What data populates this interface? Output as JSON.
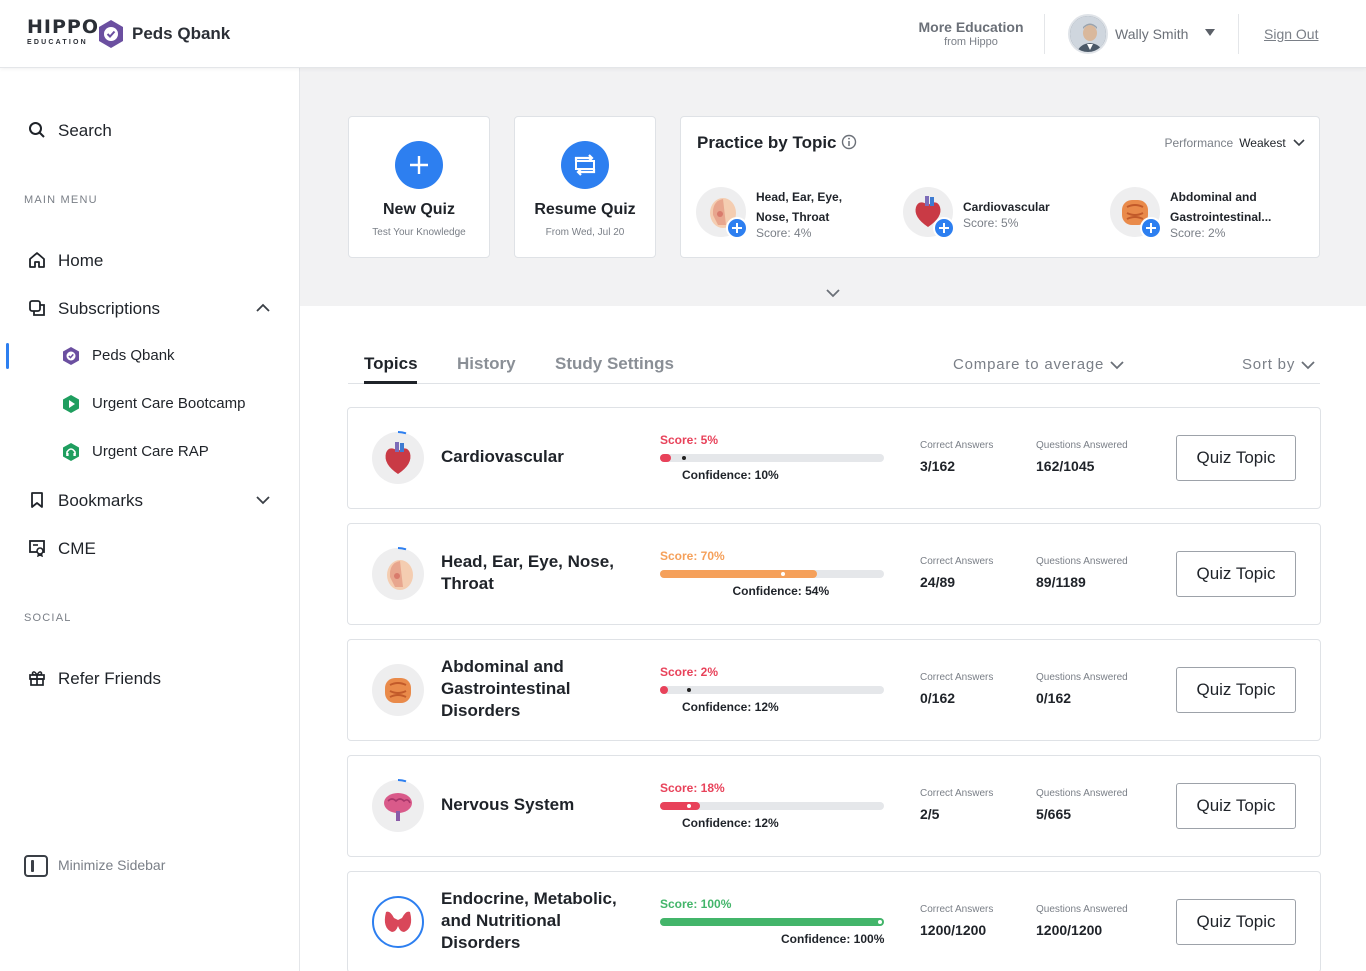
{
  "header": {
    "logo_main": "HIPPO",
    "logo_sub": "EDUCATION",
    "brand": "Peds Qbank",
    "more_title": "More Education",
    "more_sub": "from Hippo",
    "user_name": "Wally Smith",
    "sign_out": "Sign Out"
  },
  "sidebar": {
    "search": "Search",
    "main_menu": "MAIN MENU",
    "home": "Home",
    "subscriptions": "Subscriptions",
    "sub_items": [
      "Peds Qbank",
      "Urgent Care Bootcamp",
      "Urgent Care RAP"
    ],
    "bookmarks": "Bookmarks",
    "cme": "CME",
    "social": "SOCIAL",
    "refer": "Refer Friends",
    "minimize": "Minimize Sidebar"
  },
  "quick": {
    "new_title": "New Quiz",
    "new_sub": "Test Your Knowledge",
    "resume_title": "Resume Quiz",
    "resume_sub": "From Wed, Jul 20"
  },
  "practice": {
    "title": "Practice by Topic",
    "perf_label": "Performance",
    "perf_value": "Weakest",
    "items": [
      {
        "name": "Head, Ear, Eye, Nose, Throat",
        "score": "Score: 4%"
      },
      {
        "name": "Cardiovascular",
        "score": "Score: 5%"
      },
      {
        "name": "Abdominal and Gastrointestinal...",
        "score": "Score: 2%"
      }
    ]
  },
  "tabs": {
    "topics": "Topics",
    "history": "History",
    "settings": "Study Settings",
    "compare": "Compare to average",
    "sort": "Sort by"
  },
  "labels": {
    "correct": "Correct Answers",
    "answered": "Questions Answered",
    "quiz_btn": "Quiz Topic"
  },
  "topics": [
    {
      "name": "Cardiovascular",
      "score_text": "Score: 5%",
      "score": 5,
      "confidence_text": "Confidence: 10%",
      "confidence": 10,
      "correct": "3/162",
      "answered": "162/1045",
      "color": "#e8425a"
    },
    {
      "name": "Head, Ear, Eye, Nose, Throat",
      "score_text": "Score: 70%",
      "score": 70,
      "confidence_text": "Confidence: 54%",
      "confidence": 54,
      "correct": "24/89",
      "answered": "89/1189",
      "color": "#f5a05a"
    },
    {
      "name": "Abdominal and Gastrointestinal Disorders",
      "score_text": "Score: 2%",
      "score": 2,
      "confidence_text": "Confidence: 12%",
      "confidence": 12,
      "correct": "0/162",
      "answered": "0/162",
      "color": "#e8425a"
    },
    {
      "name": "Nervous System",
      "score_text": "Score: 18%",
      "score": 18,
      "confidence_text": "Confidence: 12%",
      "confidence": 12,
      "correct": "2/5",
      "answered": "5/665",
      "color": "#e8425a"
    },
    {
      "name": "Endocrine, Metabolic, and Nutritional Disorders",
      "score_text": "Score: 100%",
      "score": 100,
      "confidence_text": "Confidence: 100%",
      "confidence": 100,
      "correct": "1200/1200",
      "answered": "1200/1200",
      "color": "#43b56a"
    }
  ],
  "colors": {
    "accent": "#2d7ff0",
    "brand": "#6b4fa0",
    "low": "#e8425a",
    "mid": "#f5a05a",
    "high": "#43b56a"
  }
}
